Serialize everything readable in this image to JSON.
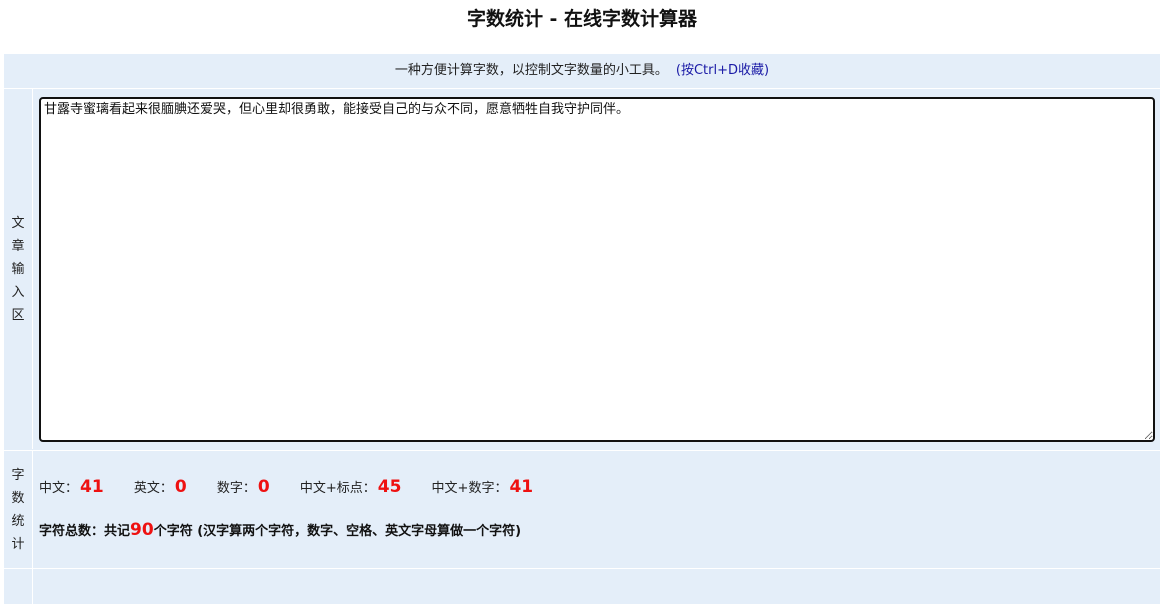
{
  "page": {
    "title": "字数统计 - 在线字数计算器"
  },
  "intro": {
    "text": "一种方便计算字数，以控制文字数量的小工具。",
    "bookmark_hint": "(按Ctrl+D收藏)"
  },
  "input_section": {
    "label": "文章输入区",
    "value": "甘露寺蜜璃看起来很腼腆还爱哭，但心里却很勇敢，能接受自己的与众不同，愿意牺牲自我守护同伴。"
  },
  "stats_section": {
    "label": "字数统计",
    "chinese_label": "中文：",
    "chinese_value": "41",
    "english_label": "英文：",
    "english_value": "0",
    "digits_label": "数字：",
    "digits_value": "0",
    "chinese_punct_label": "中文+标点：",
    "chinese_punct_value": "45",
    "chinese_digits_label": "中文+数字：",
    "chinese_digits_value": "41",
    "total_prefix": "字符总数：共记",
    "total_value": "90",
    "total_suffix": "个字符 (汉字算两个字符，数字、空格、英文字母算做一个字符)"
  },
  "colors": {
    "panel_background": "#e4eef9",
    "highlight_number": "#ee1111",
    "link_blue": "#1a1aa6"
  }
}
